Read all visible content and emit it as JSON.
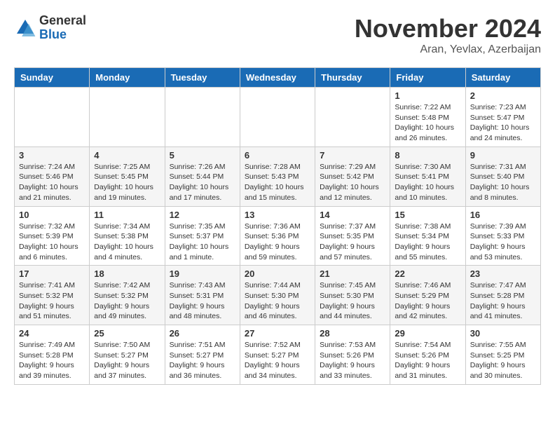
{
  "logo": {
    "general": "General",
    "blue": "Blue"
  },
  "title": {
    "month": "November 2024",
    "location": "Aran, Yevlax, Azerbaijan"
  },
  "weekdays": [
    "Sunday",
    "Monday",
    "Tuesday",
    "Wednesday",
    "Thursday",
    "Friday",
    "Saturday"
  ],
  "weeks": [
    [
      {
        "day": "",
        "info": ""
      },
      {
        "day": "",
        "info": ""
      },
      {
        "day": "",
        "info": ""
      },
      {
        "day": "",
        "info": ""
      },
      {
        "day": "",
        "info": ""
      },
      {
        "day": "1",
        "info": "Sunrise: 7:22 AM\nSunset: 5:48 PM\nDaylight: 10 hours and 26 minutes."
      },
      {
        "day": "2",
        "info": "Sunrise: 7:23 AM\nSunset: 5:47 PM\nDaylight: 10 hours and 24 minutes."
      }
    ],
    [
      {
        "day": "3",
        "info": "Sunrise: 7:24 AM\nSunset: 5:46 PM\nDaylight: 10 hours and 21 minutes."
      },
      {
        "day": "4",
        "info": "Sunrise: 7:25 AM\nSunset: 5:45 PM\nDaylight: 10 hours and 19 minutes."
      },
      {
        "day": "5",
        "info": "Sunrise: 7:26 AM\nSunset: 5:44 PM\nDaylight: 10 hours and 17 minutes."
      },
      {
        "day": "6",
        "info": "Sunrise: 7:28 AM\nSunset: 5:43 PM\nDaylight: 10 hours and 15 minutes."
      },
      {
        "day": "7",
        "info": "Sunrise: 7:29 AM\nSunset: 5:42 PM\nDaylight: 10 hours and 12 minutes."
      },
      {
        "day": "8",
        "info": "Sunrise: 7:30 AM\nSunset: 5:41 PM\nDaylight: 10 hours and 10 minutes."
      },
      {
        "day": "9",
        "info": "Sunrise: 7:31 AM\nSunset: 5:40 PM\nDaylight: 10 hours and 8 minutes."
      }
    ],
    [
      {
        "day": "10",
        "info": "Sunrise: 7:32 AM\nSunset: 5:39 PM\nDaylight: 10 hours and 6 minutes."
      },
      {
        "day": "11",
        "info": "Sunrise: 7:34 AM\nSunset: 5:38 PM\nDaylight: 10 hours and 4 minutes."
      },
      {
        "day": "12",
        "info": "Sunrise: 7:35 AM\nSunset: 5:37 PM\nDaylight: 10 hours and 1 minute."
      },
      {
        "day": "13",
        "info": "Sunrise: 7:36 AM\nSunset: 5:36 PM\nDaylight: 9 hours and 59 minutes."
      },
      {
        "day": "14",
        "info": "Sunrise: 7:37 AM\nSunset: 5:35 PM\nDaylight: 9 hours and 57 minutes."
      },
      {
        "day": "15",
        "info": "Sunrise: 7:38 AM\nSunset: 5:34 PM\nDaylight: 9 hours and 55 minutes."
      },
      {
        "day": "16",
        "info": "Sunrise: 7:39 AM\nSunset: 5:33 PM\nDaylight: 9 hours and 53 minutes."
      }
    ],
    [
      {
        "day": "17",
        "info": "Sunrise: 7:41 AM\nSunset: 5:32 PM\nDaylight: 9 hours and 51 minutes."
      },
      {
        "day": "18",
        "info": "Sunrise: 7:42 AM\nSunset: 5:32 PM\nDaylight: 9 hours and 49 minutes."
      },
      {
        "day": "19",
        "info": "Sunrise: 7:43 AM\nSunset: 5:31 PM\nDaylight: 9 hours and 48 minutes."
      },
      {
        "day": "20",
        "info": "Sunrise: 7:44 AM\nSunset: 5:30 PM\nDaylight: 9 hours and 46 minutes."
      },
      {
        "day": "21",
        "info": "Sunrise: 7:45 AM\nSunset: 5:30 PM\nDaylight: 9 hours and 44 minutes."
      },
      {
        "day": "22",
        "info": "Sunrise: 7:46 AM\nSunset: 5:29 PM\nDaylight: 9 hours and 42 minutes."
      },
      {
        "day": "23",
        "info": "Sunrise: 7:47 AM\nSunset: 5:28 PM\nDaylight: 9 hours and 41 minutes."
      }
    ],
    [
      {
        "day": "24",
        "info": "Sunrise: 7:49 AM\nSunset: 5:28 PM\nDaylight: 9 hours and 39 minutes."
      },
      {
        "day": "25",
        "info": "Sunrise: 7:50 AM\nSunset: 5:27 PM\nDaylight: 9 hours and 37 minutes."
      },
      {
        "day": "26",
        "info": "Sunrise: 7:51 AM\nSunset: 5:27 PM\nDaylight: 9 hours and 36 minutes."
      },
      {
        "day": "27",
        "info": "Sunrise: 7:52 AM\nSunset: 5:27 PM\nDaylight: 9 hours and 34 minutes."
      },
      {
        "day": "28",
        "info": "Sunrise: 7:53 AM\nSunset: 5:26 PM\nDaylight: 9 hours and 33 minutes."
      },
      {
        "day": "29",
        "info": "Sunrise: 7:54 AM\nSunset: 5:26 PM\nDaylight: 9 hours and 31 minutes."
      },
      {
        "day": "30",
        "info": "Sunrise: 7:55 AM\nSunset: 5:25 PM\nDaylight: 9 hours and 30 minutes."
      }
    ]
  ]
}
